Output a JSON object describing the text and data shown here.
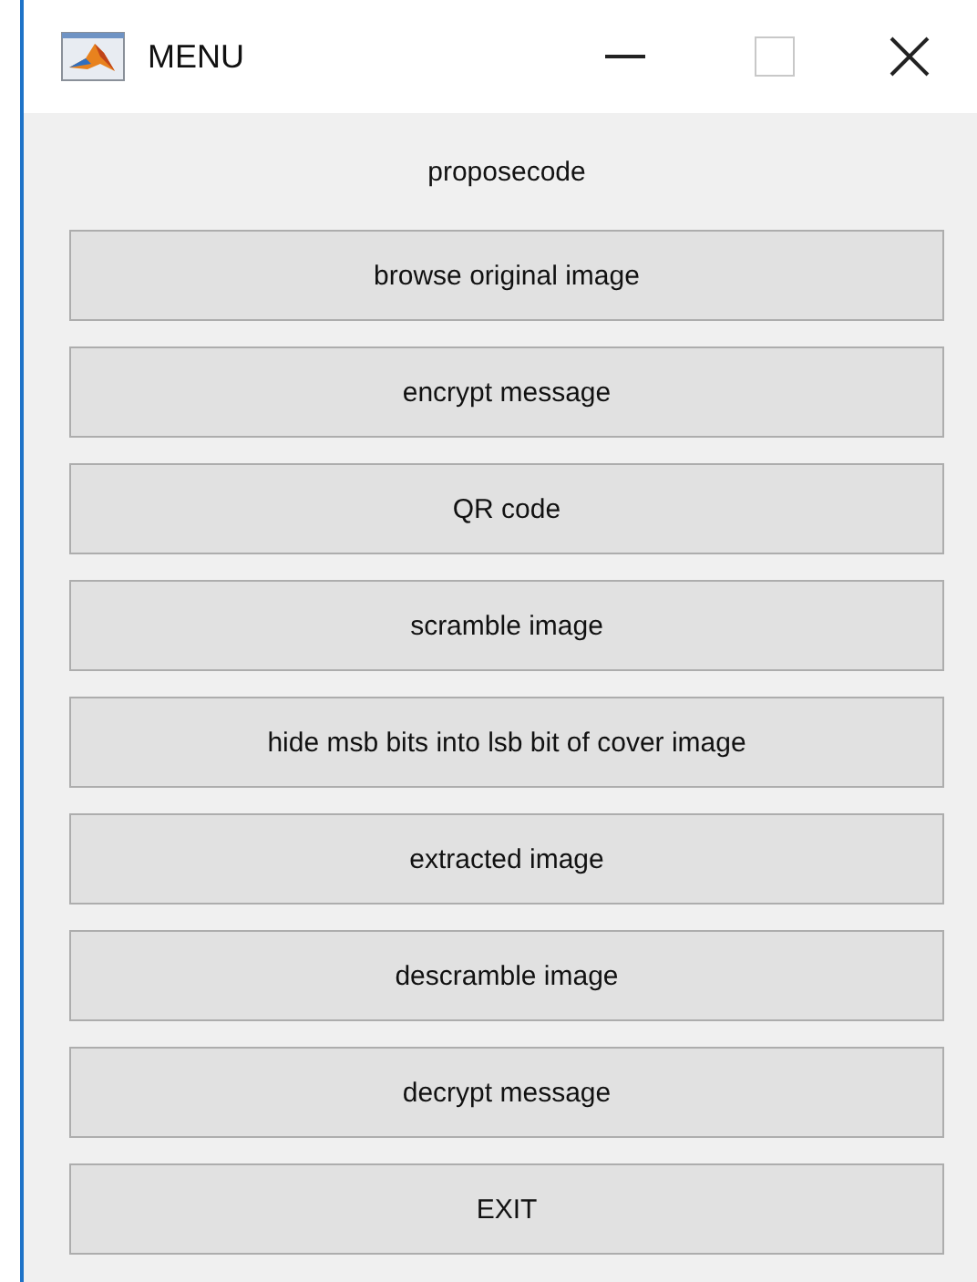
{
  "window": {
    "title": "MENU"
  },
  "heading": "proposecode",
  "buttons": [
    "browse original image",
    "encrypt message",
    "QR code",
    "scramble image",
    "hide msb bits into lsb bit of cover image",
    "extracted image",
    "descramble image",
    "decrypt message",
    "EXIT"
  ]
}
